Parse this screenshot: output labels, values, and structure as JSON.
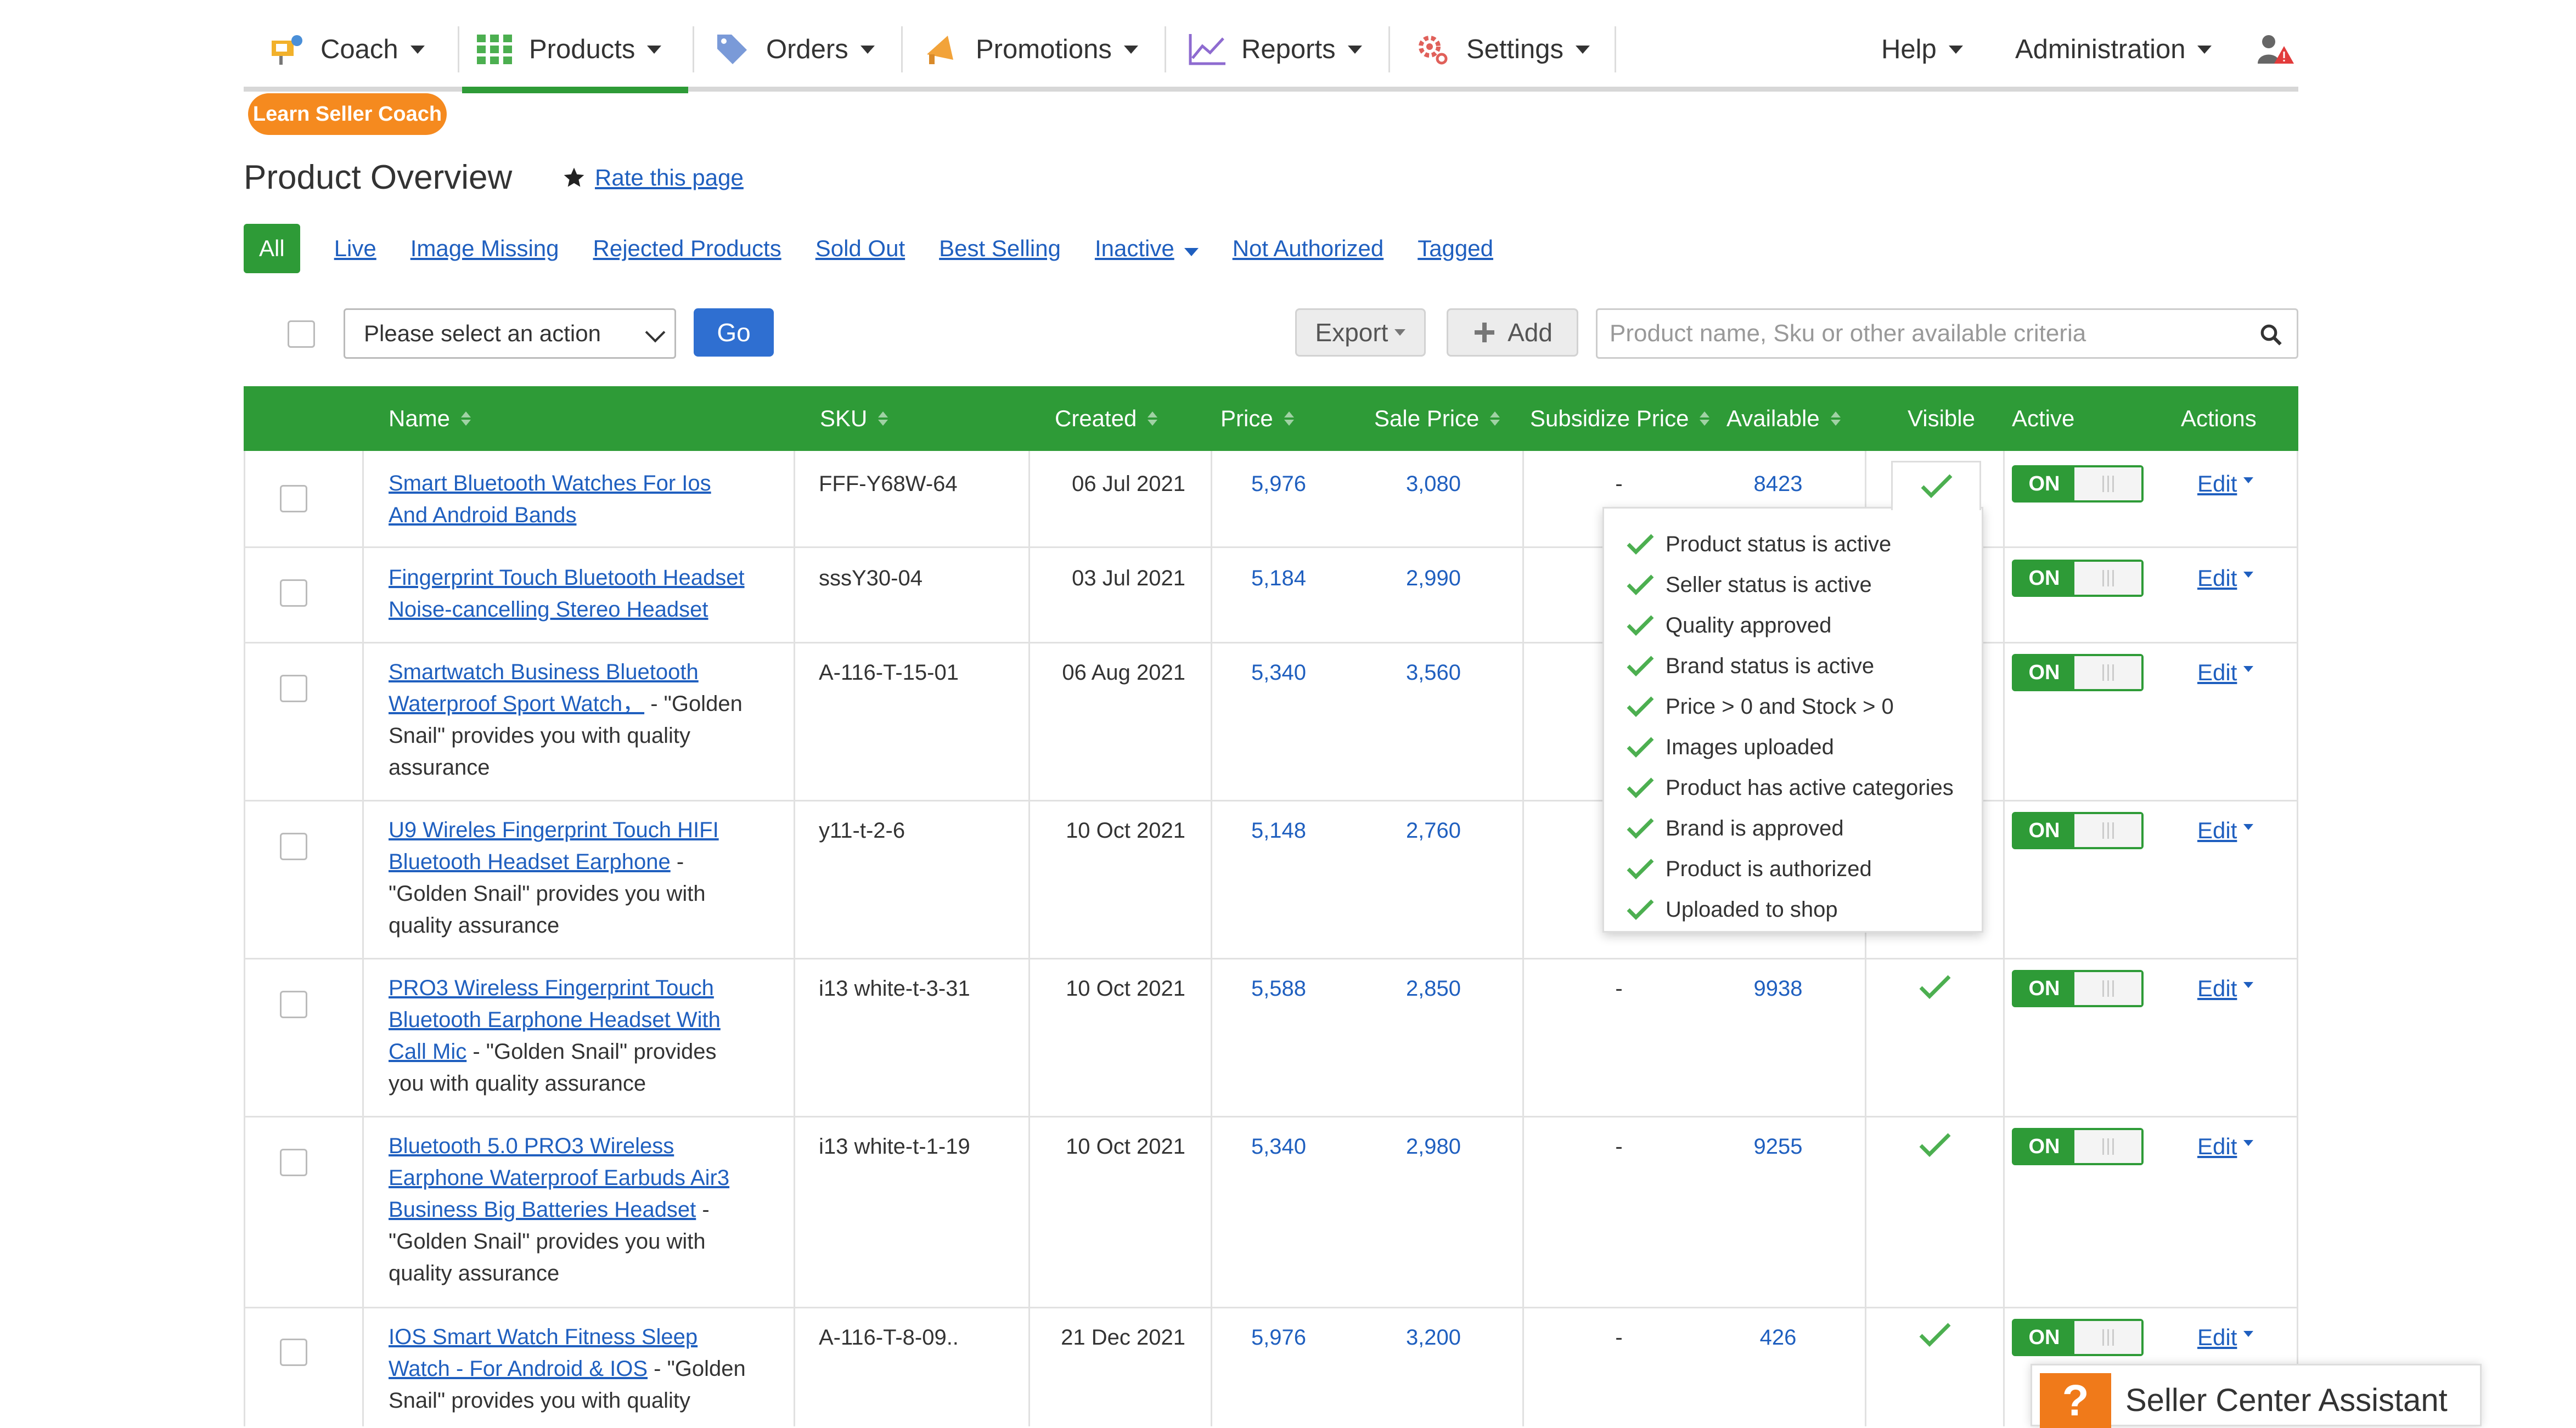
{
  "nav": {
    "items": [
      {
        "label": "Coach",
        "icon": "coach-icon"
      },
      {
        "label": "Products",
        "icon": "grid-icon"
      },
      {
        "label": "Orders",
        "icon": "tag-icon"
      },
      {
        "label": "Promotions",
        "icon": "megaphone-icon"
      },
      {
        "label": "Reports",
        "icon": "chart-icon"
      },
      {
        "label": "Settings",
        "icon": "gear-icon"
      }
    ],
    "help": "Help",
    "administration": "Administration",
    "active_color": "#2e9b37"
  },
  "coach_pill": "Learn Seller Coach",
  "page_title": "Product Overview",
  "rate_link": "Rate this page",
  "filters": {
    "all": "All",
    "live": "Live",
    "image_missing": "Image Missing",
    "rejected": "Rejected Products",
    "sold_out": "Sold Out",
    "best_selling": "Best Selling",
    "inactive": "Inactive",
    "not_authorized": "Not Authorized",
    "tagged": "Tagged"
  },
  "toolbar": {
    "action_select": "Please select an action",
    "go": "Go",
    "export": "Export",
    "add": "Add",
    "search_placeholder": "Product name, Sku or other available criteria"
  },
  "table": {
    "headers": {
      "name": "Name",
      "sku": "SKU",
      "created": "Created",
      "price": "Price",
      "sale_price": "Sale Price",
      "subsidize_price": "Subsidize Price",
      "available": "Available",
      "visible": "Visible",
      "active": "Active",
      "actions": "Actions"
    },
    "rows": [
      {
        "name_l1": "Smart Bluetooth Watches For Ios",
        "name_l2": "And Android Bands",
        "sku": "FFF-Y68W-64",
        "created": "06 Jul 2021",
        "price": "5,976",
        "sale": "3,080",
        "subsidize": "-",
        "available": "8423",
        "active": "ON",
        "edit": "Edit"
      },
      {
        "name_l1": "Fingerprint Touch Bluetooth Headset",
        "name_l2": "Noise-cancelling Stereo Headset",
        "sku": "sssY30-04",
        "created": "03 Jul 2021",
        "price": "5,184",
        "sale": "2,990",
        "active": "ON",
        "edit": "Edit"
      },
      {
        "name_l1": "Smartwatch Business Bluetooth",
        "name_l2": "Waterproof Sport Watch，",
        "suffix_l2": " - \"Golden",
        "desc_l3": "Snail\" provides you with quality",
        "desc_l4": "assurance",
        "sku": "A-116-T-15-01",
        "created": "06 Aug 2021",
        "price": "5,340",
        "sale": "3,560",
        "active": "ON",
        "edit": "Edit"
      },
      {
        "name_l1": "U9 Wireles Fingerprint Touch HIFI",
        "name_l2": "Bluetooth Headset Earphone",
        "suffix_l2": " -",
        "desc_l3": "\"Golden Snail\" provides you with",
        "desc_l4": "quality assurance",
        "sku": "y11-t-2-6",
        "created": "10 Oct 2021",
        "price": "5,148",
        "sale": "2,760",
        "active": "ON",
        "edit": "Edit"
      },
      {
        "name_l1": "PRO3 Wireless Fingerprint Touch",
        "name_l2": "Bluetooth Earphone Headset With",
        "name_l3": "Call Mic",
        "suffix_l3": " - \"Golden Snail\" provides",
        "desc_l4": "you with quality assurance",
        "sku": "i13 white-t-3-31",
        "created": "10 Oct 2021",
        "price": "5,588",
        "sale": "2,850",
        "subsidize": "-",
        "available": "9938",
        "active": "ON",
        "edit": "Edit"
      },
      {
        "name_l1": "Bluetooth 5.0 PRO3 Wireless",
        "name_l2": "Earphone Waterproof Earbuds Air3",
        "name_l3": "Business Big Batteries Headset",
        "suffix_l3": " -",
        "desc_l4": "\"Golden Snail\" provides you with",
        "desc_l5": "quality assurance",
        "sku": "i13 white-t-1-19",
        "created": "10 Oct 2021",
        "price": "5,340",
        "sale": "2,980",
        "subsidize": "-",
        "available": "9255",
        "active": "ON",
        "edit": "Edit"
      },
      {
        "name_l1": "IOS Smart Watch Fitness Sleep",
        "name_l2": "Watch - For Android & IOS",
        "suffix_l2": " - \"Golden",
        "desc_l3": "Snail\" provides you with quality",
        "sku": "A-116-T-8-09..",
        "created": "21 Dec 2021",
        "price": "5,976",
        "sale": "3,200",
        "subsidize": "-",
        "available": "426",
        "active": "ON",
        "edit": "Edit"
      }
    ]
  },
  "visibility_popover": [
    "Product status is active",
    "Seller status is active",
    "Quality approved",
    "Brand status is active",
    "Price > 0 and Stock > 0",
    "Images uploaded",
    "Product has active categories",
    "Brand is approved",
    "Product is authorized",
    "Uploaded to shop"
  ],
  "assistant": {
    "label": "Seller Center Assistant",
    "icon": "?"
  }
}
